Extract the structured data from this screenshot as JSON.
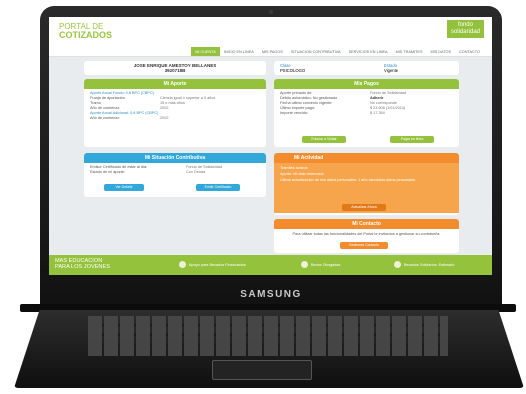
{
  "device_brand": "SAMSUNG",
  "site": {
    "logo_line1": "PORTAL DE",
    "logo_line2": "COTIZADOS",
    "fondo_line1": "fondo",
    "fondo_line2": "solidaridad"
  },
  "nav": [
    "MI CUENTA",
    "INICIO EN LINEA",
    "MIS PAGOS",
    "SITUACION CONTRIBUTIVA",
    "SERVICIOS EN LINEA",
    "MIS TRAMITES",
    "MIS DATOS",
    "CONTACTO"
  ],
  "user": {
    "name": "JOSE ENRIQUE AMESTOY BELLANES",
    "id": "3920718B"
  },
  "info": {
    "class_label": "Clase",
    "class_value": "PSICOLOGO",
    "status_label": "Estado",
    "status_value": "Vigente"
  },
  "aporte": {
    "title": "Mi Aporte",
    "link1": "Aporte Anual Fondo: 0,6 BPC (CBPC)",
    "rows1": [
      [
        "Franja de aportación",
        "Ciencia igual o superior a 5 años"
      ],
      [
        "Tramo",
        "15 o más años"
      ],
      [
        "Año de comienzo",
        "2002"
      ]
    ],
    "link2": "Aporte Anual Adicional: 0,6 BPC (CBPC)",
    "rows2": [
      [
        "Año de comienzo",
        "2002"
      ]
    ]
  },
  "pagos": {
    "title": "Mis Pagos",
    "rows": [
      [
        "Aporte primado de:",
        "Fondo de Solidaridad"
      ],
      [
        "Débito automático: No gestionado",
        "Adherir"
      ],
      [
        "Fecha último convenio vigente:",
        "No corresponde"
      ],
      [
        "Último importe pago:",
        "$ 23.608 (1/01/2014)"
      ],
      [
        "Importe vencido:",
        "$ 17.354"
      ]
    ],
    "btn_left": "Enlazar a Visitar",
    "btn_right": "Pagar en linea"
  },
  "situacion": {
    "title": "Mi Situación Contributiva",
    "rows": [
      [
        "Emisor Certificado de estar al día:",
        "Fondo de Solidaridad"
      ],
      [
        "Estado de mi aporte:",
        "Con Deuda"
      ]
    ],
    "btn_left": "Ver Detalle",
    "btn_right": "Emitir Certificado"
  },
  "actividad": {
    "title": "Mi Actividad",
    "lines": [
      "Trámites activos",
      "Aporte: Mi dato reservado",
      "Última actualización de mis datos personales: 1 año atendidas datos personales"
    ],
    "btn": "Actualizar Ahora"
  },
  "contacto": {
    "title": "Mi Contacto",
    "text": "Para utilizar todas las funcionalidades del Portal te invitamos a gestionar su contraseña.",
    "btn": "Gestionar Contacto"
  },
  "footer": {
    "line1": "MAS EDUCACION",
    "line2": "PARA LOS JOVENES",
    "items": [
      "Apoyo para Becados Financiados",
      "Becas Otorgadas",
      "Becados Solidarios: Estimado"
    ]
  }
}
